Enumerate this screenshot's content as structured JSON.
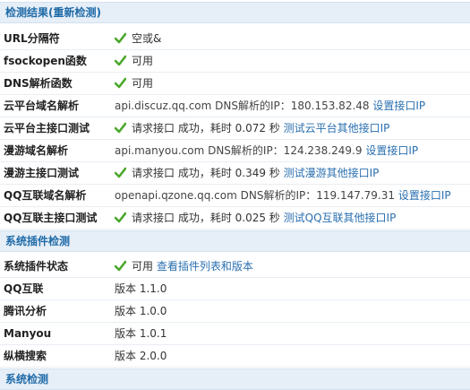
{
  "sections": [
    {
      "title": "检测结果(重新检测)"
    },
    {
      "title": "系统插件检测"
    },
    {
      "title": "系统检测"
    }
  ],
  "rows": [
    {
      "label": "URL分隔符",
      "status": "空或&"
    },
    {
      "label": "fsockopen函数",
      "status": "可用"
    },
    {
      "label": "DNS解析函数",
      "status": "可用"
    },
    {
      "label": "云平台域名解析",
      "host": "api.discuz.qq.com DNS解析的IP：180.153.82.48",
      "link": "设置接口IP"
    },
    {
      "label": "云平台主接口测试",
      "status": "请求接口 成功，耗时 0.072 秒",
      "link": "测试云平台其他接口IP"
    },
    {
      "label": "漫游域名解析",
      "host": "api.manyou.com DNS解析的IP：124.238.249.9",
      "link": "设置接口IP"
    },
    {
      "label": "漫游主接口测试",
      "status": "请求接口 成功，耗时 0.349 秒",
      "link": "测试漫游其他接口IP"
    },
    {
      "label": "QQ互联域名解析",
      "host": "openapi.qzone.qq.com DNS解析的IP：119.147.79.31",
      "link": "设置接口IP"
    },
    {
      "label": "QQ互联主接口测试",
      "status": "请求接口 成功，耗时 0.025 秒",
      "link": "测试QQ互联其他接口IP"
    }
  ],
  "plugin_rows": [
    {
      "label": "系统插件状态",
      "status": "可用",
      "link": "查看插件列表和版本"
    },
    {
      "label": "QQ互联",
      "version": "版本 1.1.0"
    },
    {
      "label": "腾讯分析",
      "version": "版本 1.0.0"
    },
    {
      "label": "Manyou",
      "version": "版本 1.0.1"
    },
    {
      "label": "纵横搜索",
      "version": "版本 2.0.0"
    }
  ],
  "colors": {
    "check": "#4aa82a",
    "link": "#2a6fb0",
    "header_bg": "#e6eef7",
    "header_text": "#1f6ba8"
  },
  "icons": {
    "status": "check-icon"
  }
}
